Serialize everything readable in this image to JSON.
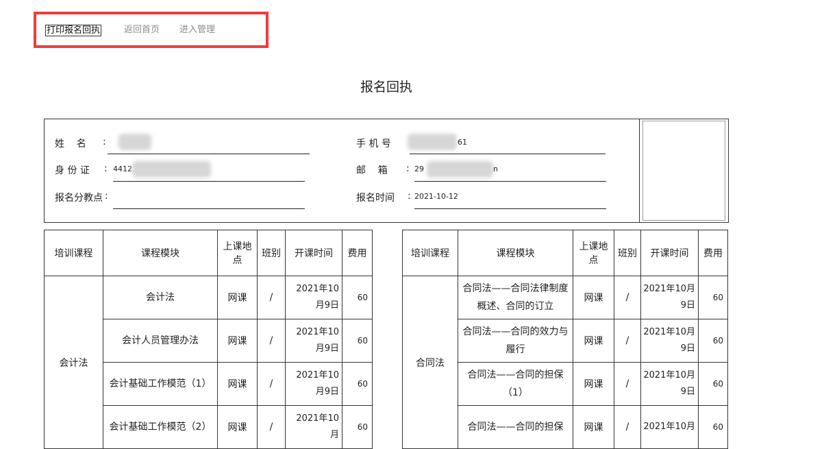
{
  "nav": {
    "print_label": "打印报名回执",
    "home_label": "返回首页",
    "admin_label": "进入管理"
  },
  "page_title": "报名回执",
  "info": {
    "name_label": "姓    名",
    "name_value": "",
    "phone_label": "手 机 号",
    "phone_value": "61",
    "id_label": "身 份 证",
    "id_value": "4412",
    "email_label": "邮    箱",
    "email_value": "29",
    "email_tail": "n",
    "branch_label": "报名分教点",
    "branch_value": "",
    "time_label": "报名时间",
    "time_value": "2021-10-12"
  },
  "table_headers": [
    "培训课程",
    "课程模块",
    "上课地点",
    "班别",
    "开课时间",
    "费用"
  ],
  "left_table": {
    "course": "会计法",
    "rows": [
      {
        "module": "会计法",
        "location": "网课",
        "class": "/",
        "date": "2021年10月9日",
        "fee": "60"
      },
      {
        "module": "会计人员管理办法",
        "location": "网课",
        "class": "/",
        "date": "2021年10月9日",
        "fee": "60"
      },
      {
        "module": "会计基础工作模范（1）",
        "location": "网课",
        "class": "/",
        "date": "2021年10月9日",
        "fee": "60"
      },
      {
        "module": "会计基础工作模范（2）",
        "location": "网课",
        "class": "/",
        "date": "2021年10月",
        "fee": "60"
      }
    ]
  },
  "right_table": {
    "course": "合同法",
    "rows": [
      {
        "module": "合同法——合同法律制度概述、合同的订立",
        "location": "网课",
        "class": "/",
        "date": "2021年10月9日",
        "fee": "60"
      },
      {
        "module": "合同法——合同的效力与履行",
        "location": "网课",
        "class": "/",
        "date": "2021年10月9日",
        "fee": "60"
      },
      {
        "module": "合同法——合同的担保（1）",
        "location": "网课",
        "class": "/",
        "date": "2021年10月9日",
        "fee": "60"
      },
      {
        "module": "合同法——合同的担保",
        "location": "网课",
        "class": "/",
        "date": "2021年10月",
        "fee": "60"
      }
    ]
  }
}
